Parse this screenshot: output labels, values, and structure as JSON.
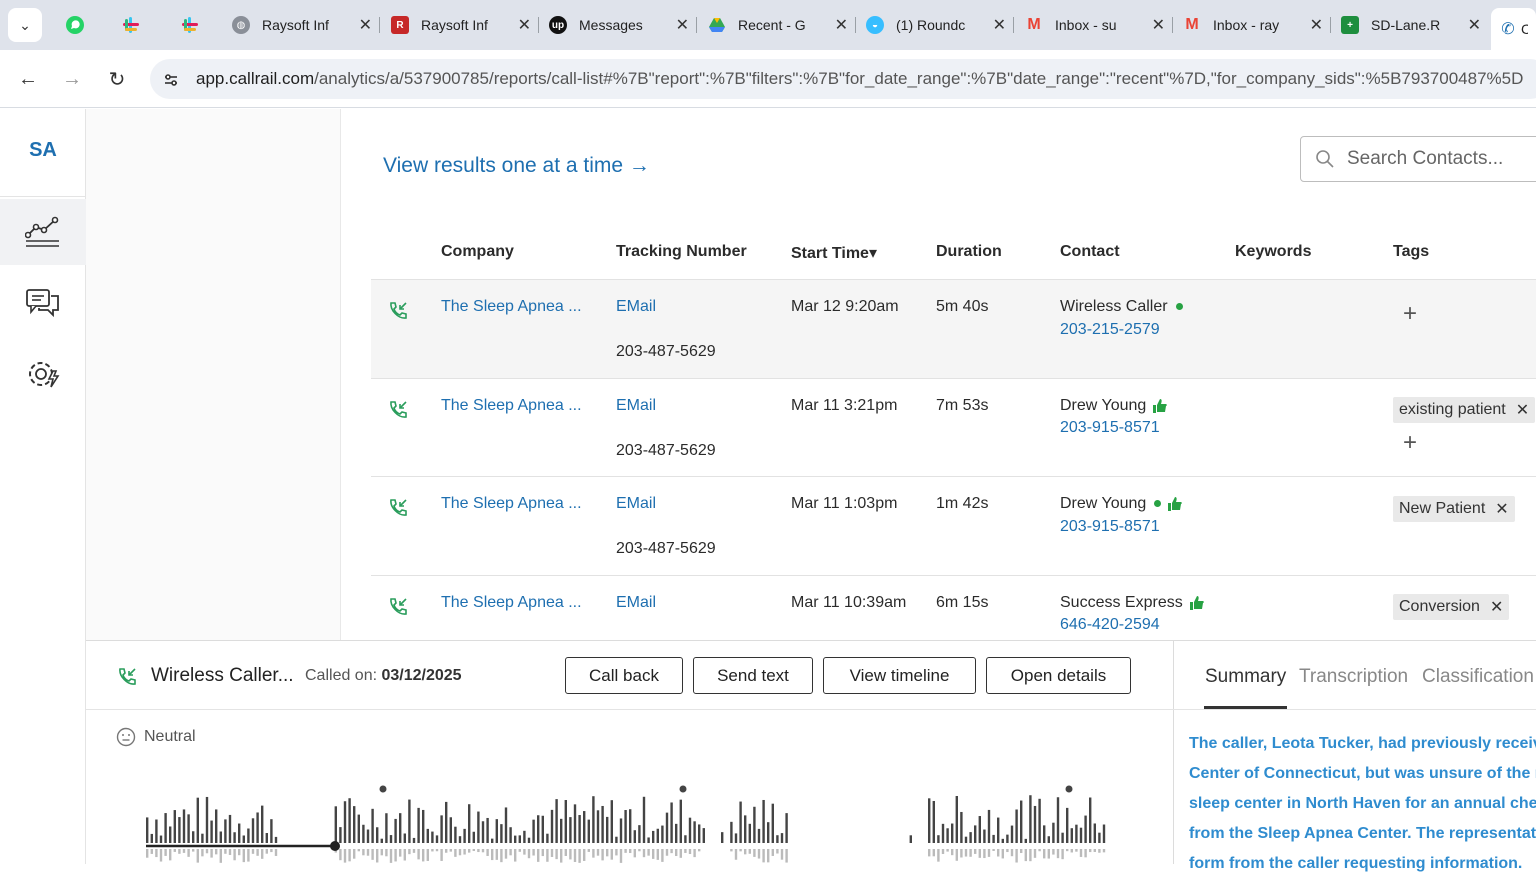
{
  "browser": {
    "tabs": [
      {
        "title": "Raysoft Inf",
        "favicon": "globe-icon"
      },
      {
        "title": "Raysoft Inf",
        "favicon": "raysoft-icon"
      },
      {
        "title": "Messages",
        "favicon": "upwork-icon"
      },
      {
        "title": "Recent - G",
        "favicon": "drive-icon"
      },
      {
        "title": "(1) Roundc",
        "favicon": "roundcube-icon"
      },
      {
        "title": "Inbox - su",
        "favicon": "gmail-icon"
      },
      {
        "title": "Inbox - ray",
        "favicon": "gmail-icon"
      },
      {
        "title": "SD-Lane.R",
        "favicon": "sheets-icon"
      },
      {
        "title": "C",
        "favicon": "callrail-icon"
      }
    ],
    "url_host": "app.callrail.com",
    "url_path": "/analytics/a/537900785/reports/call-list#%7B\"report\":%7B\"filters\":%7B\"for_date_range\":%7B\"date_range\":\"recent\"%7D,\"for_company_sids\":%5B793700487%5D"
  },
  "rail": {
    "avatar": "SA"
  },
  "main": {
    "results_link": "View results one at a time →",
    "search_placeholder": "Search Contacts...",
    "columns": [
      "Company",
      "Tracking Number",
      "Start Time▾",
      "Duration",
      "Contact",
      "Keywords",
      "Tags"
    ],
    "rows": [
      {
        "company": "The Sleep Apnea ...",
        "source": "EMail",
        "tracking": "203-487-5629",
        "start": "Mar 12 9:20am",
        "duration": "5m 40s",
        "contact": "Wireless Caller",
        "phone": "203-215-2579",
        "tags": []
      },
      {
        "company": "The Sleep Apnea ...",
        "source": "EMail",
        "tracking": "203-487-5629",
        "start": "Mar 11 3:21pm",
        "duration": "7m 53s",
        "contact": "Drew Young",
        "phone": "203-915-8571",
        "tags": [
          "existing patient"
        ]
      },
      {
        "company": "The Sleep Apnea ...",
        "source": "EMail",
        "tracking": "203-487-5629",
        "start": "Mar 11 1:03pm",
        "duration": "1m 42s",
        "contact": "Drew Young",
        "phone": "203-915-8571",
        "tags": [
          "New Patient"
        ]
      },
      {
        "company": "The Sleep Apnea ...",
        "source": "EMail",
        "tracking": "",
        "start": "Mar 11 10:39am",
        "duration": "6m 15s",
        "contact": "Success Express",
        "phone": "646-420-2594",
        "tags": [
          "Conversion"
        ]
      }
    ]
  },
  "detail": {
    "caller": "Wireless Caller...",
    "called_on_label": "Called on:",
    "called_on_date": "03/12/2025",
    "buttons": [
      "Call back",
      "Send text",
      "View timeline",
      "Open details"
    ],
    "sentiment": "Neutral"
  },
  "side": {
    "tabs": [
      "Summary",
      "Transcription",
      "Classification"
    ],
    "summary_lines": [
      "The caller, Leota Tucker, had previously receive",
      "Center of Connecticut, but was unsure of the re",
      "sleep center in North Haven for an annual chec",
      "from the Sleep Apnea Center. The representati",
      "form from the caller requesting information. "
    ]
  },
  "colors": {
    "link": "#1e6fb0",
    "accent_green": "#27a243",
    "summary_text": "#2f8ccf"
  }
}
